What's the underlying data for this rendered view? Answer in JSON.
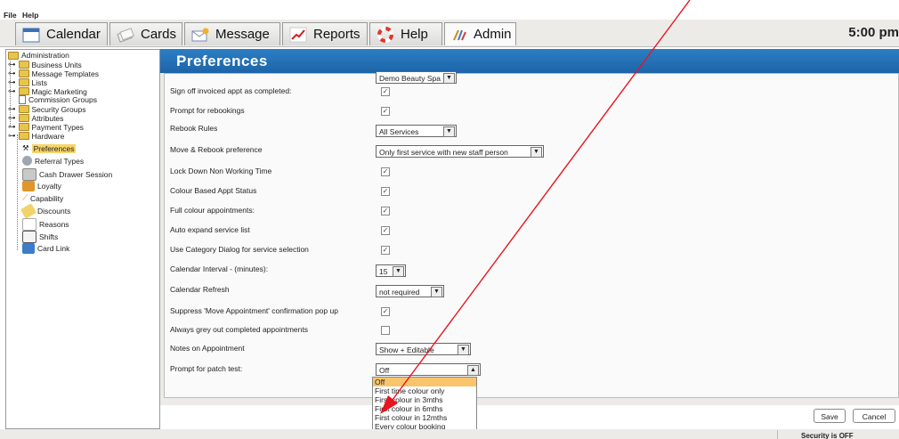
{
  "menu": {
    "file": "File",
    "help": "Help"
  },
  "tabs": [
    {
      "label": "Calendar",
      "icon": "calendar-icon"
    },
    {
      "label": "Cards",
      "icon": "cards-icon"
    },
    {
      "label": "Message",
      "icon": "envelope-icon"
    },
    {
      "label": "Reports",
      "icon": "chart-icon"
    },
    {
      "label": "Help",
      "icon": "lifebuoy-icon"
    },
    {
      "label": "Admin",
      "icon": "tools-icon"
    }
  ],
  "clock": "5:00 pm",
  "tree": {
    "root": "Administration",
    "folders": [
      "Business Units",
      "Message Templates",
      "Lists",
      "Magic Marketing"
    ],
    "commission": "Commission Groups",
    "folders2": [
      "Security Groups",
      "Attributes",
      "Payment Types",
      "Hardware"
    ],
    "leaves": [
      "Preferences",
      "Referral Types",
      "Cash Drawer Session",
      "Loyalty",
      "Capability",
      "Discounts",
      "Reasons",
      "Shifts",
      "Card Link"
    ]
  },
  "panel": {
    "title": "Preferences",
    "top_value": "Demo Beauty Spa",
    "rows": [
      {
        "label": "Sign off invoiced appt as completed:",
        "type": "check",
        "checked": true
      },
      {
        "label": "Prompt for rebookings",
        "type": "check",
        "checked": true
      },
      {
        "label": "Rebook Rules",
        "type": "select",
        "value": "All Services"
      },
      {
        "label": "Move & Rebook preference",
        "type": "select",
        "value": "Only first service with new staff person"
      },
      {
        "label": "Lock Down Non Working Time",
        "type": "check",
        "checked": true
      },
      {
        "label": "Colour Based Appt Status",
        "type": "check",
        "checked": true
      },
      {
        "label": "Full colour appointments:",
        "type": "check",
        "checked": true
      },
      {
        "label": "Auto expand service list",
        "type": "check",
        "checked": true
      },
      {
        "label": "Use Category Dialog for service selection",
        "type": "check",
        "checked": true
      },
      {
        "label": "Calendar Interval - (minutes):",
        "type": "select",
        "value": "15"
      },
      {
        "label": "Calendar Refresh",
        "type": "select",
        "value": "not required"
      },
      {
        "label": "Suppress 'Move Appointment' confirmation pop up",
        "type": "check",
        "checked": true
      },
      {
        "label": "Always grey out completed appointments",
        "type": "check",
        "checked": false
      },
      {
        "label": "Notes on Appointment",
        "type": "select",
        "value": "Show + Editable"
      },
      {
        "label": "Prompt for patch test:",
        "type": "select",
        "value": "Off"
      }
    ],
    "dropdown_options": [
      "Off",
      "First time colour only",
      "First colour in 3mths",
      "First colour in 6mths",
      "First colour in 12mths",
      "Every colour booking"
    ],
    "dropdown_selected": "Off"
  },
  "buttons": {
    "save": "Save",
    "cancel": "Cancel"
  },
  "status": {
    "security": "Security is OFF"
  },
  "annotation_color": "#e8141e"
}
